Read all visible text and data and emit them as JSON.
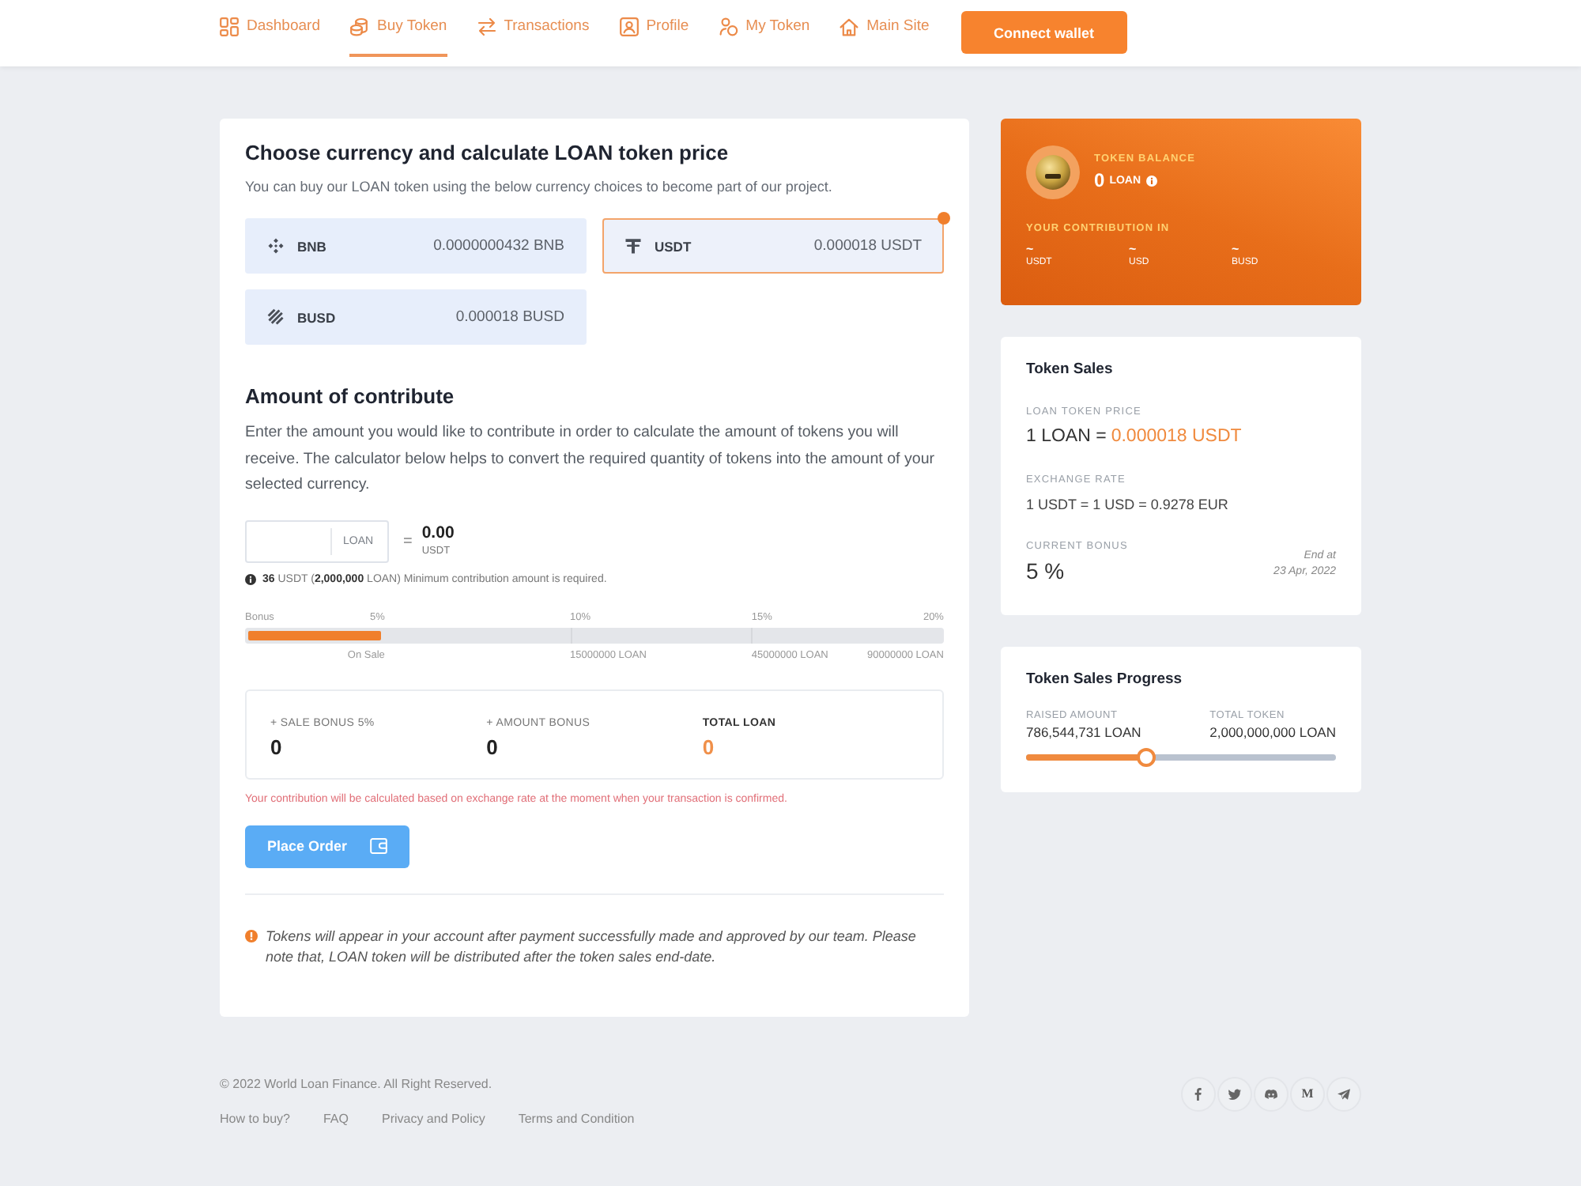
{
  "nav": {
    "items": [
      {
        "label": "Dashboard",
        "selected": false
      },
      {
        "label": "Buy Token",
        "selected": true
      },
      {
        "label": "Transactions",
        "selected": false
      },
      {
        "label": "Profile",
        "selected": false
      },
      {
        "label": "My Token",
        "selected": false
      },
      {
        "label": "Main Site",
        "selected": false
      }
    ],
    "connect_button": "Connect wallet"
  },
  "currency_panel": {
    "title": "Choose currency and calculate LOAN token price",
    "subtitle": "You can buy our LOAN token using the below currency choices to become part of our project.",
    "currencies": [
      {
        "name": "BNB",
        "price": "0.0000000432 BNB",
        "selected": false
      },
      {
        "name": "USDT",
        "price": "0.000018 USDT",
        "selected": true
      },
      {
        "name": "BUSD",
        "price": "0.000018 BUSD",
        "selected": false
      }
    ]
  },
  "contribute": {
    "title": "Amount of contribute",
    "description": "Enter the amount you would like to contribute in order to calculate the amount of tokens you will receive. The calculator below helps to convert the required quantity of tokens into the amount of your selected currency.",
    "amount_unit": "LOAN",
    "equals": "=",
    "result_value": "0.00",
    "result_unit": "USDT",
    "minimum_note": "**36** USDT (**2,000,000** LOAN) Minimum contribution amount is required.",
    "bonus_bar": {
      "label": "Bonus",
      "level": 0.2,
      "tiers": [
        {
          "percent": "5%",
          "amount": "On Sale"
        },
        {
          "percent": "10%",
          "amount": "15000000 LOAN"
        },
        {
          "percent": "15%",
          "amount": "45000000 LOAN"
        },
        {
          "percent": "20%",
          "amount": "90000000 LOAN"
        }
      ]
    },
    "summary": [
      {
        "label": "+ SALE BONUS 5%",
        "value": "0",
        "kind": "plain"
      },
      {
        "label": "+ AMOUNT BONUS",
        "value": "0",
        "kind": "plain"
      },
      {
        "label": "TOTAL LOAN",
        "value": "0",
        "kind": "total"
      }
    ],
    "rate_note": "Your contribution will be calculated based on exchange rate at the moment when your transaction is confirmed.",
    "place_order_button": "Place Order",
    "tokens_note": "Tokens will appear in your account after payment successfully made and approved by our team. Please note that, LOAN token will be distributed after the token sales end-date."
  },
  "balance": {
    "label": "TOKEN BALANCE",
    "amount": "0",
    "unit": "LOAN",
    "contribution_label": "YOUR CONTRIBUTION IN",
    "contributions": [
      {
        "value": "~",
        "unit": "USDT"
      },
      {
        "value": "~",
        "unit": "USD"
      },
      {
        "value": "~",
        "unit": "BUSD"
      }
    ]
  },
  "token_sales": {
    "title": "Token Sales",
    "price_label": "LOAN TOKEN PRICE",
    "price_base": "1 LOAN =",
    "price_value": "0.000018 USDT",
    "rate_label": "EXCHANGE RATE",
    "rate": "1 USDT = 1 USD = 0.9278 EUR",
    "bonus_label": "CURRENT BONUS",
    "bonus": "5 %",
    "end_label": "End at",
    "end_date": "23 Apr, 2022"
  },
  "sales_progress": {
    "title": "Token Sales Progress",
    "raised_label": "RAISED AMOUNT",
    "raised": "786,544,731 LOAN",
    "total_label": "TOTAL TOKEN",
    "total": "2,000,000,000 LOAN",
    "level": 0.39
  },
  "footer": {
    "copyright": "© 2022 World Loan Finance. All Right Reserved.",
    "links": [
      "How to buy?",
      "FAQ",
      "Privacy and Policy",
      "Terms and Condition"
    ],
    "social": [
      {
        "kind": "facebook"
      },
      {
        "kind": "twitter"
      },
      {
        "kind": "discord"
      },
      {
        "kind": "medium",
        "glyph": "M"
      },
      {
        "kind": "telegram"
      }
    ]
  }
}
